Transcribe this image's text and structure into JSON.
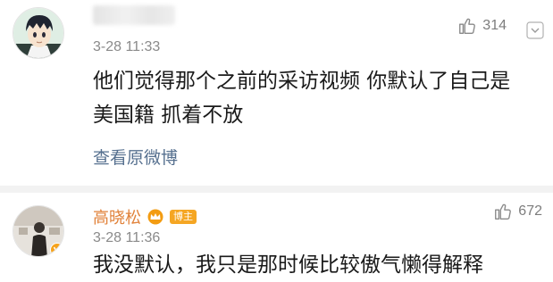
{
  "comments": [
    {
      "time": "3-28 11:33",
      "likes": "314",
      "text": "他们觉得那个之前的采访视频 你默认了自己是美国籍 抓着不放",
      "view_link": "查看原微博",
      "avatar_icon": "anime-boy-avatar",
      "more_icon": "chevron-down-icon"
    },
    {
      "username": "高晓松",
      "badge": "博主",
      "time": "3-28 11:36",
      "likes": "672",
      "text": "我没默认，我只是那时候比较傲气懒得解释",
      "avatar_icon": "user-photo-avatar",
      "verified_icon": "crown-icon",
      "username_color": "#e1823a"
    }
  ]
}
